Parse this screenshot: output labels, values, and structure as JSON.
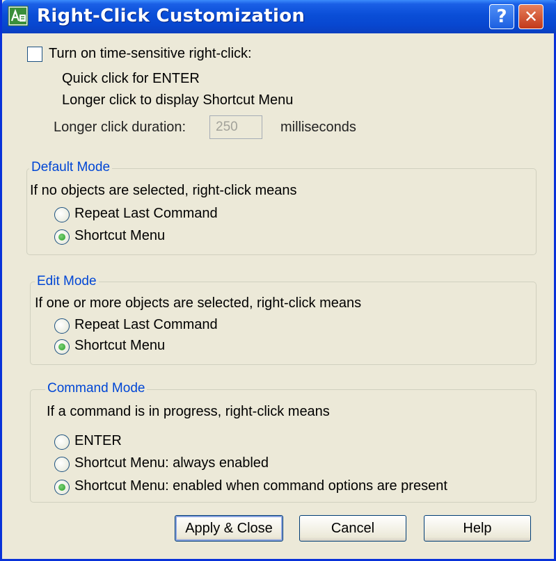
{
  "window": {
    "title": "Right-Click Customization"
  },
  "titlebar": {
    "help_glyph": "?",
    "close_glyph": "✕"
  },
  "time_sensitive": {
    "checked": false,
    "label": "Turn on time-sensitive right-click:",
    "line1": "Quick click for ENTER",
    "line2": "Longer click to display Shortcut Menu",
    "duration_label": "Longer click duration:",
    "duration_value": "250",
    "duration_unit": "milliseconds"
  },
  "default_mode": {
    "legend": "Default Mode",
    "prompt": "If no objects are selected, right-click means",
    "options": [
      "Repeat Last Command",
      "Shortcut Menu"
    ],
    "selected": "Shortcut Menu"
  },
  "edit_mode": {
    "legend": "Edit Mode",
    "prompt": "If one or more objects are selected, right-click means",
    "options": [
      "Repeat Last Command",
      "Shortcut Menu"
    ],
    "selected": "Shortcut Menu"
  },
  "command_mode": {
    "legend": "Command Mode",
    "prompt": "If a command is in progress, right-click means",
    "options": [
      "ENTER",
      "Shortcut Menu: always enabled",
      "Shortcut Menu: enabled when command options are present"
    ],
    "selected": "Shortcut Menu: enabled when command options are present"
  },
  "buttons": {
    "apply": "Apply & Close",
    "cancel": "Cancel",
    "help": "Help"
  },
  "colors": {
    "titlebar": "#0a4ed7",
    "group_legend": "#0046d5",
    "dialog_bg": "#ece9d8",
    "radio_dot": "#21a121"
  }
}
